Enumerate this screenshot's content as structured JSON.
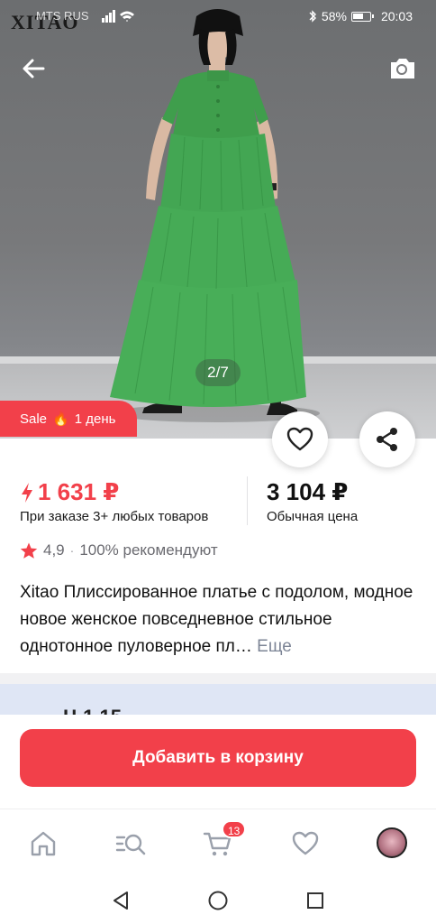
{
  "status_bar": {
    "brand_watermark": "XITAO",
    "carrier": "MTS RUS",
    "battery": "58%",
    "time": "20:03"
  },
  "gallery": {
    "counter": "2/7"
  },
  "sale_badge": {
    "label": "Sale",
    "flame": "🔥",
    "duration": "1 день"
  },
  "price": {
    "promo_value": "1 631 ₽",
    "promo_note": "При заказе 3+ любых товаров",
    "regular_value": "3 104 ₽",
    "regular_note": "Обычная цена"
  },
  "rating": {
    "score": "4,9",
    "recommend": "100% рекомендуют"
  },
  "product": {
    "title": "Xitao Плиссированное платье с подолом, модное новое женское повседневное стильное однотонное пуловерное пл…",
    "more_link": "Еще"
  },
  "next_section": {
    "partial_text": "Ц          1  15"
  },
  "cta": {
    "add_to_cart": "Добавить в корзину"
  },
  "bottom_nav": {
    "cart_count": "13"
  },
  "colors": {
    "accent": "#f2404a",
    "muted_link": "#7d8596"
  },
  "icons": [
    "back-arrow-icon",
    "camera-icon",
    "heart-icon",
    "share-icon",
    "flash-icon",
    "star-icon",
    "home-icon",
    "search-catalog-icon",
    "cart-icon",
    "favorites-icon",
    "back-triangle-icon",
    "home-circle-icon",
    "recents-square-icon"
  ]
}
